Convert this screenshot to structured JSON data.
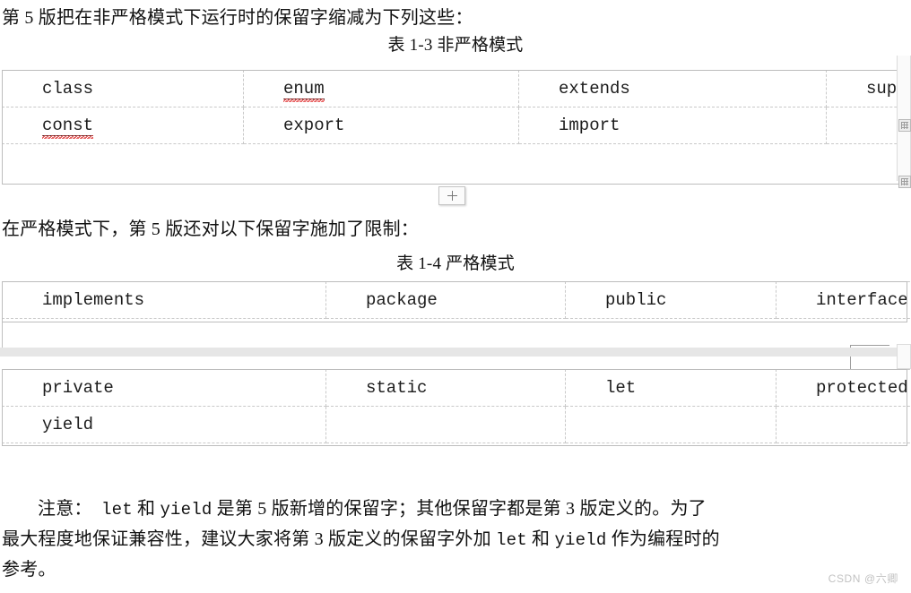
{
  "document": {
    "intro_nonstrict": "第 5 版把在非严格模式下运行时的保留字缩减为下列这些：",
    "caption_13": "表 1-3 非严格模式",
    "intro_strict": "在严格模式下，第 5 版还对以下保留字施加了限制：",
    "caption_14": "表 1-4 严格模式"
  },
  "table_13": {
    "rows": [
      [
        "class",
        "enum",
        "extends",
        "super"
      ],
      [
        "const",
        "export",
        "import",
        ""
      ]
    ],
    "misspelled": [
      "enum",
      "const"
    ]
  },
  "table_14a": {
    "rows": [
      [
        "implements",
        "package",
        "public",
        "interface"
      ]
    ]
  },
  "table_14b": {
    "rows": [
      [
        "private",
        "static",
        "let",
        "protected"
      ],
      [
        "yield",
        "",
        "",
        ""
      ]
    ]
  },
  "controls": {
    "add_row_label": "+",
    "add_row_icon": "plus-icon",
    "table_handle_icon": "table-move-handle-icon"
  },
  "note": {
    "lead": "注意：",
    "line1_a": "let",
    "line1_b": "和",
    "line1_c": "yield",
    "line1_d": "是第 5 版新增的保留字；其他保留字都是第 3 版定义的。为了",
    "line2_a": "最大程度地保证兼容性，建议大家将第 3 版定义的保留字外加",
    "line2_b": "let",
    "line2_c": "和",
    "line2_d": "yield",
    "line2_e": "作为编程时的",
    "line3": "参考。"
  },
  "watermark": {
    "text": "CSDN @六卿"
  },
  "colors": {
    "text": "#121212",
    "table_border_dashed": "#c9c9c9",
    "table_border_solid": "#bdbdbd",
    "spellcheck": "#e03030",
    "page_break": "#e6e6e6",
    "watermark": "#c2c2c2"
  }
}
